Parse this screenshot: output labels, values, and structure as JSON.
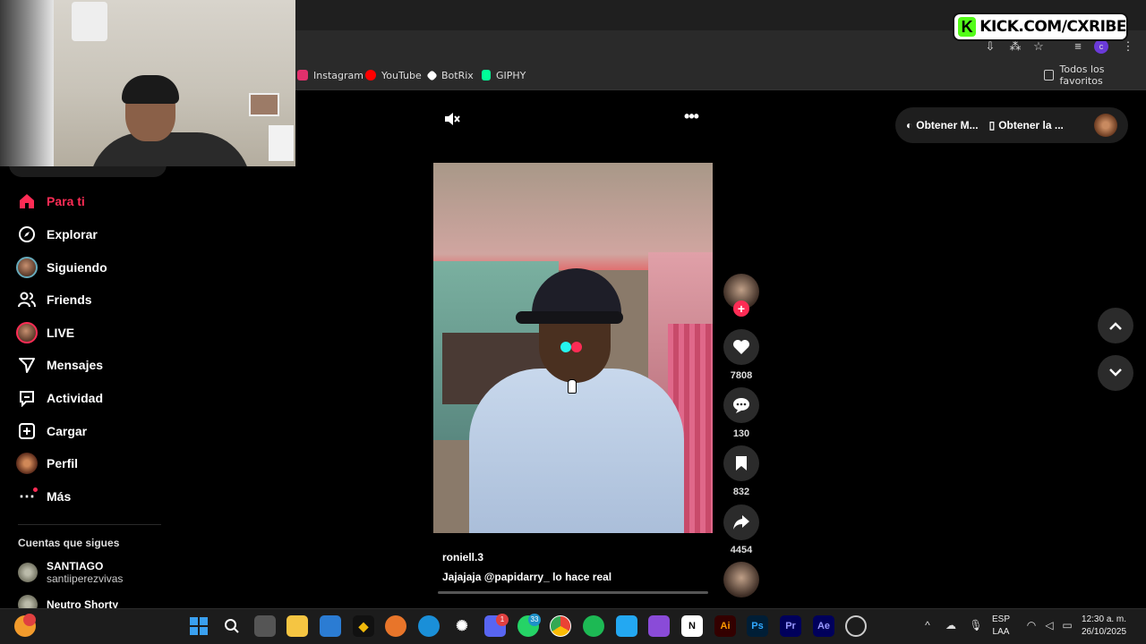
{
  "overlay": {
    "kick_label": "KICK.COM/CXRIBE",
    "kick_letter": "K"
  },
  "bookmarks": {
    "items": [
      {
        "label": "Instagram",
        "icon": "instagram-icon",
        "color": "#e1306c"
      },
      {
        "label": "YouTube",
        "icon": "youtube-icon",
        "color": "#ff0000"
      },
      {
        "label": "BotRix",
        "icon": "botrix-icon",
        "color": "#ffffff"
      },
      {
        "label": "GIPHY",
        "icon": "giphy-icon",
        "color": "#00ff99"
      }
    ],
    "all_favorites": "Todos los favoritos"
  },
  "sidebar": {
    "items": [
      {
        "label": "Para ti",
        "icon": "home-icon",
        "active": true
      },
      {
        "label": "Explorar",
        "icon": "compass-icon"
      },
      {
        "label": "Siguiendo",
        "icon": "following-avatar"
      },
      {
        "label": "Friends",
        "icon": "friends-icon"
      },
      {
        "label": "LIVE",
        "icon": "live-avatar"
      },
      {
        "label": "Mensajes",
        "icon": "send-icon"
      },
      {
        "label": "Actividad",
        "icon": "activity-icon"
      },
      {
        "label": "Cargar",
        "icon": "upload-icon"
      },
      {
        "label": "Perfil",
        "icon": "profile-avatar"
      },
      {
        "label": "Más",
        "icon": "more-icon"
      }
    ],
    "following_title": "Cuentas que sigues",
    "following": [
      {
        "name": "SANTIAGO",
        "handle": "santiiperezvivas"
      },
      {
        "name": "Neutro Shorty",
        "handle": ""
      }
    ]
  },
  "video": {
    "username": "roniell.3",
    "caption": "Jajajaja @papidarry_  lo hace real",
    "progress": 0.0
  },
  "actions": {
    "likes": "7808",
    "comments": "130",
    "saves": "832",
    "shares": "4454"
  },
  "top_pill": {
    "item1": "Obtener M...",
    "item2": "Obtener la ..."
  },
  "taskbar": {
    "discord_badge": "1",
    "whatsapp_badge": "33",
    "adobe_label": "Ai",
    "ps_label": "Ps",
    "pr_label": "Pr",
    "ae_label": "Ae",
    "notion_label": "N",
    "lang_top": "ESP",
    "lang_bottom": "LAA",
    "time": "12:30 a. m.",
    "date": "26/10/2025"
  },
  "colors": {
    "accent": "#fe2c55",
    "teal": "#25f4ee",
    "kick_green": "#53fc18"
  }
}
